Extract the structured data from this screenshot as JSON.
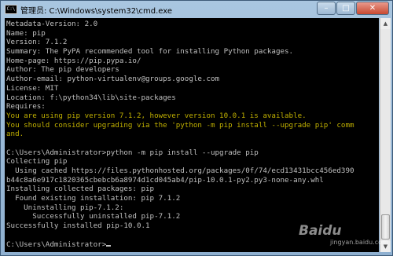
{
  "window": {
    "title": "管理员: C:\\Windows\\system32\\cmd.exe",
    "buttons": {
      "minimize": "–",
      "maximize": "□",
      "close": "✕"
    }
  },
  "console": {
    "lines": [
      {
        "text": "Metadata-Version: 2.0",
        "style": "normal"
      },
      {
        "text": "Name: pip",
        "style": "normal"
      },
      {
        "text": "Version: 7.1.2",
        "style": "normal"
      },
      {
        "text": "Summary: The PyPA recommended tool for installing Python packages.",
        "style": "normal"
      },
      {
        "text": "Home-page: https://pip.pypa.io/",
        "style": "normal"
      },
      {
        "text": "Author: The pip developers",
        "style": "normal"
      },
      {
        "text": "Author-email: python-virtualenv@groups.google.com",
        "style": "normal"
      },
      {
        "text": "License: MIT",
        "style": "normal"
      },
      {
        "text": "Location: f:\\python34\\lib\\site-packages",
        "style": "normal"
      },
      {
        "text": "Requires:",
        "style": "normal"
      },
      {
        "text": "You are using pip version 7.1.2, however version 10.0.1 is available.",
        "style": "warn"
      },
      {
        "text": "You should consider upgrading via the 'python -m pip install --upgrade pip' comm",
        "style": "warn"
      },
      {
        "text": "and.",
        "style": "warn"
      },
      {
        "text": "",
        "style": "normal"
      },
      {
        "text": "C:\\Users\\Administrator>python -m pip install --upgrade pip",
        "style": "normal"
      },
      {
        "text": "Collecting pip",
        "style": "normal"
      },
      {
        "text": "  Using cached https://files.pythonhosted.org/packages/0f/74/ecd13431bcc456ed390",
        "style": "normal"
      },
      {
        "text": "b44c8a6e917c1820365cbebcb6a8974d1cd045ab4/pip-10.0.1-py2.py3-none-any.whl",
        "style": "normal"
      },
      {
        "text": "Installing collected packages: pip",
        "style": "normal"
      },
      {
        "text": "  Found existing installation: pip 7.1.2",
        "style": "normal"
      },
      {
        "text": "    Uninstalling pip-7.1.2:",
        "style": "normal"
      },
      {
        "text": "      Successfully uninstalled pip-7.1.2",
        "style": "normal"
      },
      {
        "text": "Successfully installed pip-10.0.1",
        "style": "normal"
      },
      {
        "text": "",
        "style": "normal"
      },
      {
        "text": "C:\\Users\\Administrator>",
        "style": "normal"
      }
    ]
  },
  "watermark": {
    "text": "Baidu",
    "sub": "jingyan.baidu.com"
  },
  "colors": {
    "console_bg": "#000000",
    "console_text": "#c0c0c0",
    "warning_text": "#c0b000"
  }
}
